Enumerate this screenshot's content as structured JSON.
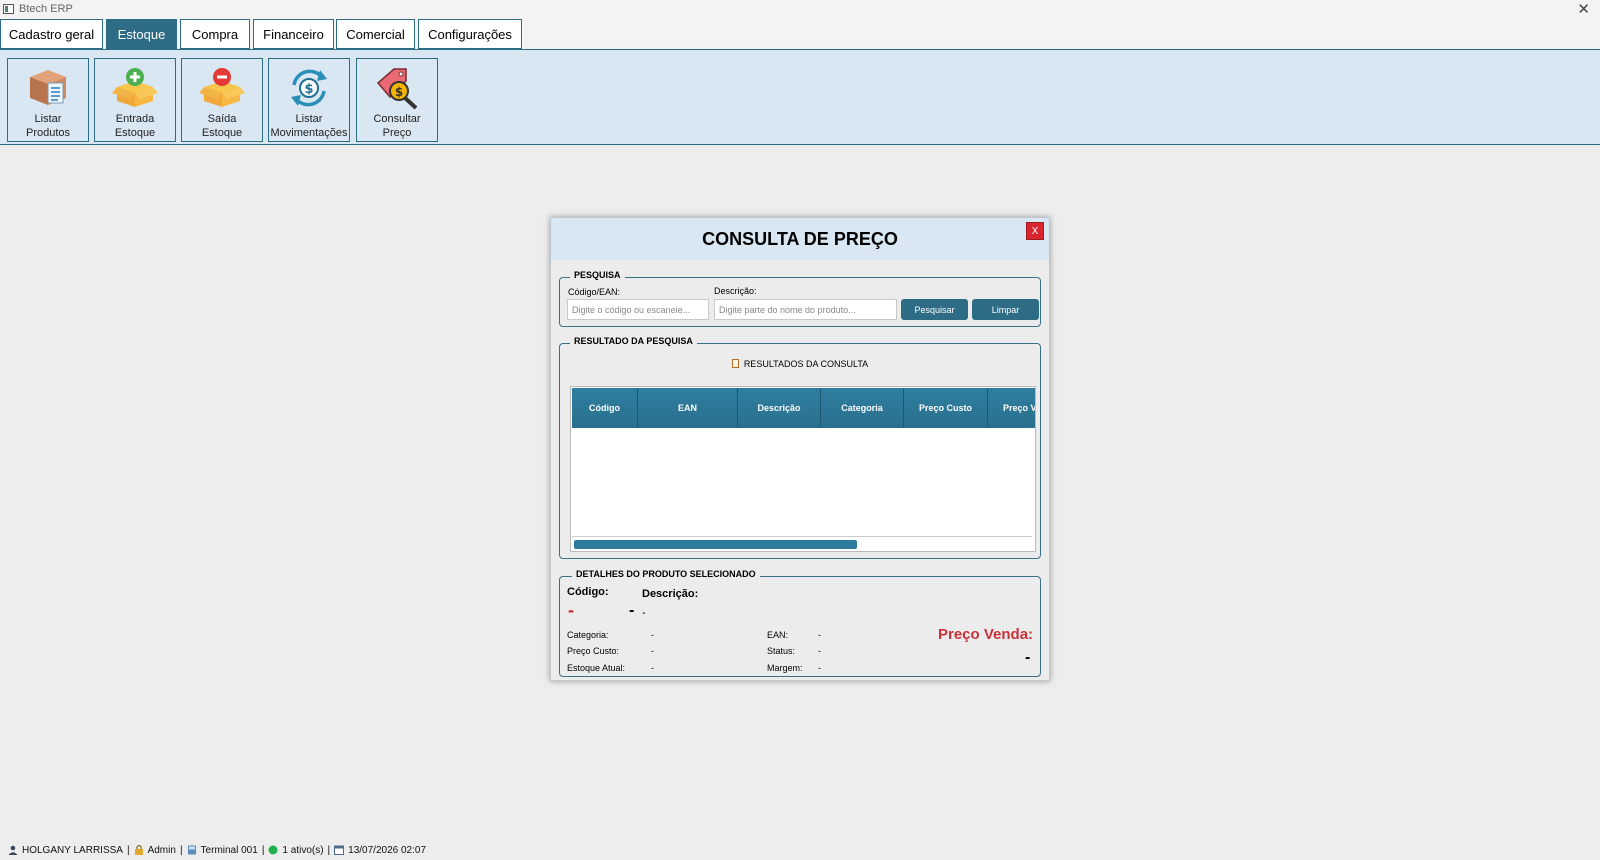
{
  "window": {
    "title": "Btech ERP",
    "close_glyph": "✕"
  },
  "tabs": [
    {
      "label": "Cadastro geral",
      "active": false
    },
    {
      "label": "Estoque",
      "active": true
    },
    {
      "label": "Compra",
      "active": false
    },
    {
      "label": "Financeiro",
      "active": false
    },
    {
      "label": "Comercial",
      "active": false
    },
    {
      "label": "Configurações",
      "active": false
    }
  ],
  "ribbon": [
    {
      "label": "Listar\nProdutos",
      "icon": "box-list-icon"
    },
    {
      "label": "Entrada\nEstoque",
      "icon": "box-plus-icon"
    },
    {
      "label": "Saída\nEstoque",
      "icon": "box-minus-icon"
    },
    {
      "label": "Listar\nMovimentações",
      "icon": "money-cycle-icon"
    },
    {
      "label": "Consultar\nPreço",
      "icon": "price-tag-search-icon"
    }
  ],
  "dialog": {
    "title": "CONSULTA DE PREÇO",
    "close_label": "X",
    "search": {
      "legend": "PESQUISA",
      "code_label": "Código/EAN:",
      "code_placeholder": "Digite o código ou escaneie...",
      "desc_label": "Descrição:",
      "desc_placeholder": "Digite parte do nome do produto...",
      "search_button": "Pesquisar",
      "clear_button": "Limpar"
    },
    "results": {
      "legend": "RESULTADO DA PESQUISA",
      "caption": "RESULTADOS DA CONSULTA",
      "columns": [
        "Código",
        "EAN",
        "Descrição",
        "Categoria",
        "Preço Custo",
        "Preço Venda"
      ],
      "rows": [],
      "scroll_fraction": 0.62
    },
    "details": {
      "legend": "DETALHES DO PRODUTO SELECIONADO",
      "codigo_label": "Código:",
      "codigo_value": "-",
      "descricao_label": "Descrição:",
      "descricao_value": "-",
      "descricao_value2": "-",
      "categoria_label": "Categoria:",
      "categoria_value": "-",
      "preco_custo_label": "Preço Custo:",
      "preco_custo_value": "-",
      "estoque_label": "Estoque Atual:",
      "estoque_value": "-",
      "ean_label": "EAN:",
      "ean_value": "-",
      "status_label": "Status:",
      "status_value": "-",
      "margem_label": "Margem:",
      "margem_value": "-",
      "preco_venda_label": "Preço Venda:",
      "preco_venda_value": "-"
    }
  },
  "statusbar": {
    "user": "HOLGANY LARRISSA",
    "role": "Admin",
    "terminal": "Terminal 001",
    "active": "1 ativo(s)",
    "datetime": "13/07/2026 02:07",
    "separator": "|"
  },
  "colors": {
    "accent": "#2e6b85",
    "ribbon_bg": "#d9e7f3",
    "danger": "#d9262e",
    "status_online": "#22b14c"
  }
}
